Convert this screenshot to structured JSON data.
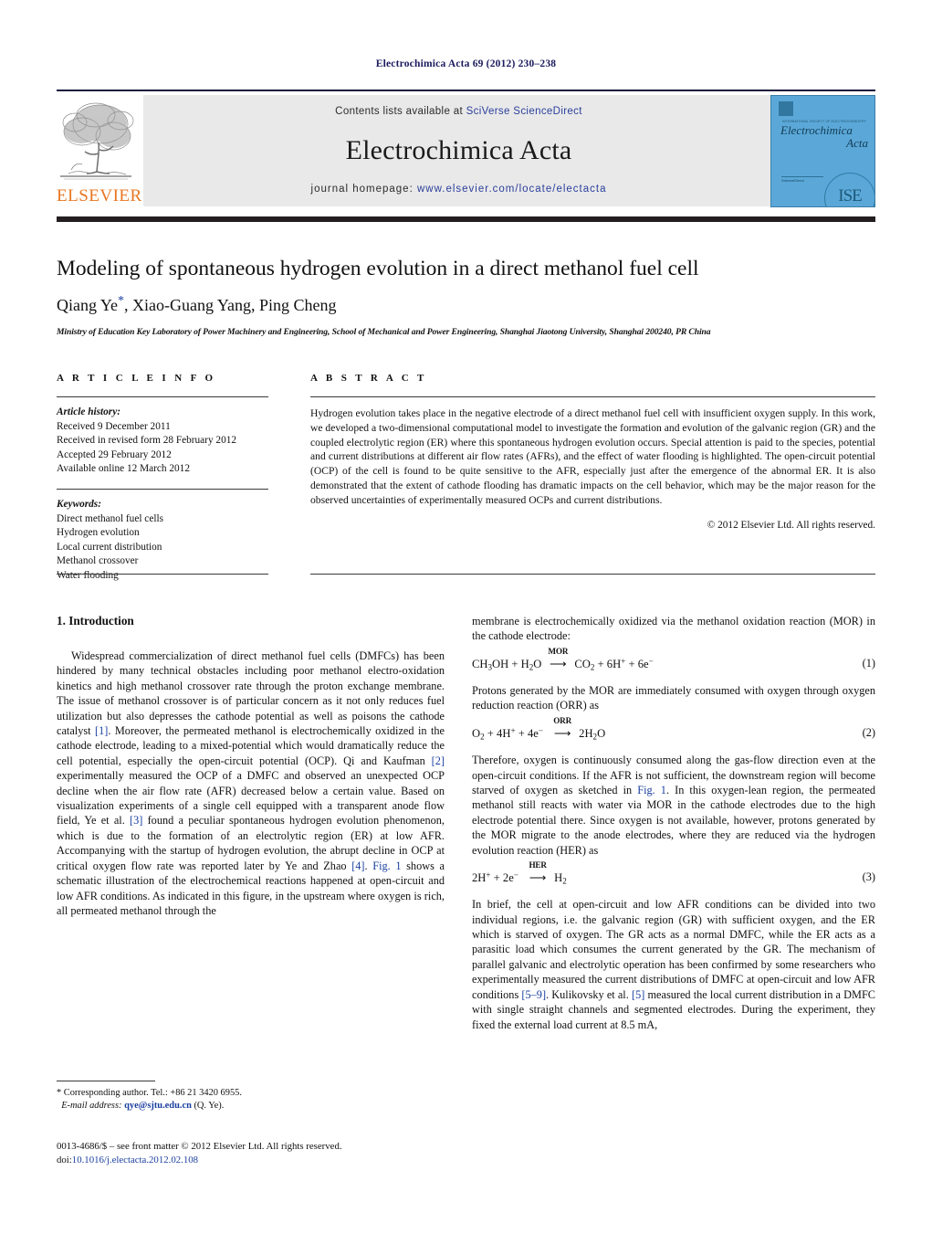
{
  "running_head": "Electrochimica Acta 69 (2012) 230–238",
  "masthead": {
    "contents_prefix": "Contents lists available at ",
    "contents_link": "SciVerse ScienceDirect",
    "journal_name": "Electrochimica Acta",
    "homepage_prefix": "journal homepage: ",
    "homepage_url": "www.elsevier.com/locate/electacta",
    "publisher_wordmark": "ELSEVIER",
    "cover": {
      "subtitle": "INTERNATIONAL SOCIETY OF ELECTROCHEMISTRY  •  ELSEVIER",
      "title_line1": "Electrochimica",
      "title_line2": "Acta",
      "publisher": "ScienceDirect",
      "society_mark": "ISE"
    }
  },
  "article": {
    "title": "Modeling of spontaneous hydrogen evolution in a direct methanol fuel cell",
    "authors": "Qiang Ye, Xiao-Guang Yang, Ping Cheng",
    "corresponding_marker": "*",
    "affiliation": "Ministry of Education Key Laboratory of Power Machinery and Engineering, School of Mechanical and Power Engineering, Shanghai Jiaotong University, Shanghai 200240, PR China"
  },
  "article_info": {
    "heading": "A R T I C L E  I N F O",
    "history_label": "Article history:",
    "history": [
      "Received 9 December 2011",
      "Received in revised form 28 February 2012",
      "Accepted 29 February 2012",
      "Available online 12 March 2012"
    ],
    "keywords_label": "Keywords:",
    "keywords": [
      "Direct methanol fuel cells",
      "Hydrogen evolution",
      "Local current distribution",
      "Methanol crossover",
      "Water flooding"
    ]
  },
  "abstract": {
    "heading": "A B S T R A C T",
    "text": "Hydrogen evolution takes place in the negative electrode of a direct methanol fuel cell with insufficient oxygen supply. In this work, we developed a two-dimensional computational model to investigate the formation and evolution of the galvanic region (GR) and the coupled electrolytic region (ER) where this spontaneous hydrogen evolution occurs. Special attention is paid to the species, potential and current distributions at different air flow rates (AFRs), and the effect of water flooding is highlighted. The open-circuit potential (OCP) of the cell is found to be quite sensitive to the AFR, especially just after the emergence of the abnormal ER. It is also demonstrated that the extent of cathode flooding has dramatic impacts on the cell behavior, which may be the major reason for the observed uncertainties of experimentally measured OCPs and current distributions.",
    "copyright": "© 2012 Elsevier Ltd. All rights reserved."
  },
  "body": {
    "section1_title": "1.  Introduction",
    "left_par1_a": "Widespread commercialization of direct methanol fuel cells (DMFCs) has been hindered by many technical obstacles including poor methanol electro-oxidation kinetics and high methanol crossover rate through the proton exchange membrane. The issue of methanol crossover is of particular concern as it not only reduces fuel utilization but also depresses the cathode potential as well as poisons the cathode catalyst ",
    "ref1": "[1]",
    "left_par1_b": ". Moreover, the permeated methanol is electrochemically oxidized in the cathode electrode, leading to a mixed-potential which would dramatically reduce the cell potential, especially the open-circuit potential (OCP). Qi and Kaufman ",
    "ref2": "[2]",
    "left_par1_c": " experimentally measured the OCP of a DMFC and observed an unexpected OCP decline when the air flow rate (AFR) decreased below a certain value. Based on visualization experiments of a single cell equipped with a transparent anode flow field, Ye et al. ",
    "ref3": "[3]",
    "left_par1_d": " found a peculiar spontaneous hydrogen evolution phenomenon, which is due to the formation of an electrolytic region (ER) at low AFR. Accompanying with the startup of hydrogen evolution, the abrupt decline in OCP at critical oxygen flow rate was reported later by Ye and Zhao ",
    "ref4": "[4]",
    "left_par1_e": ". ",
    "fig1_ref_a": "Fig. 1",
    "left_par1_f": " shows a schematic illustration of the electrochemical reactions happened at open-circuit and low AFR conditions. As indicated in this figure, in the upstream where oxygen is rich, all permeated methanol through the",
    "right_par1": "membrane is electrochemically oxidized via the methanol oxidation reaction (MOR) in the cathode electrode:",
    "eq1": {
      "lhs": "CH3OH + H2O",
      "label": "MOR",
      "rhs": "CO2 + 6H+ + 6e−",
      "number": "(1)"
    },
    "right_par2": "Protons generated by the MOR are immediately consumed with oxygen through oxygen reduction reaction (ORR) as",
    "eq2": {
      "lhs": "O2 + 4H+ + 4e−",
      "label": "ORR",
      "rhs": "2H2O",
      "number": "(2)"
    },
    "right_par3_a": "Therefore, oxygen is continuously consumed along the gas-flow direction even at the open-circuit conditions. If the AFR is not sufficient, the downstream region will become starved of oxygen as sketched in ",
    "fig1_ref_b": "Fig. 1",
    "right_par3_b": ". In this oxygen-lean region, the permeated methanol still reacts with water via MOR in the cathode electrodes due to the high electrode potential there. Since oxygen is not available, however, protons generated by the MOR migrate to the anode electrodes, where they are reduced via the hydrogen evolution reaction (HER) as",
    "eq3": {
      "lhs": "2H+ + 2e−",
      "label": "HER",
      "rhs": "H2",
      "number": "(3)"
    },
    "right_par4_a": "In brief, the cell at open-circuit and low AFR conditions can be divided into two individual regions, i.e. the galvanic region (GR) with sufficient oxygen, and the ER which is starved of oxygen. The GR acts as a normal DMFC, while the ER acts as a parasitic load which consumes the current generated by the GR. The mechanism of parallel galvanic and electrolytic operation has been confirmed by some researchers who experimentally measured the current distributions of DMFC at open-circuit and low AFR conditions ",
    "ref59": "[5–9]",
    "right_par4_b": ". Kulikovsky et al. ",
    "ref5": "[5]",
    "right_par4_c": " measured the local current distribution in a DMFC with single straight channels and segmented electrodes. During the experiment, they fixed the external load current at 8.5 mA,"
  },
  "footer": {
    "corresponding_marker": "*",
    "corresponding_text": " Corresponding author. Tel.: +86 21 3420 6955.",
    "email_label": "E-mail address:",
    "email": "qye@sjtu.edu.cn",
    "email_suffix": " (Q. Ye).",
    "issn_line": "0013-4686/$ – see front matter © 2012 Elsevier Ltd. All rights reserved.",
    "doi_label": "doi:",
    "doi": "10.1016/j.electacta.2012.02.108"
  },
  "colors": {
    "link": "#2b3f9c",
    "reference": "#1a3fa0",
    "elsevier_orange": "#e87722",
    "cover_blue": "#5ba8d8",
    "rule_dark": "#231f20"
  }
}
